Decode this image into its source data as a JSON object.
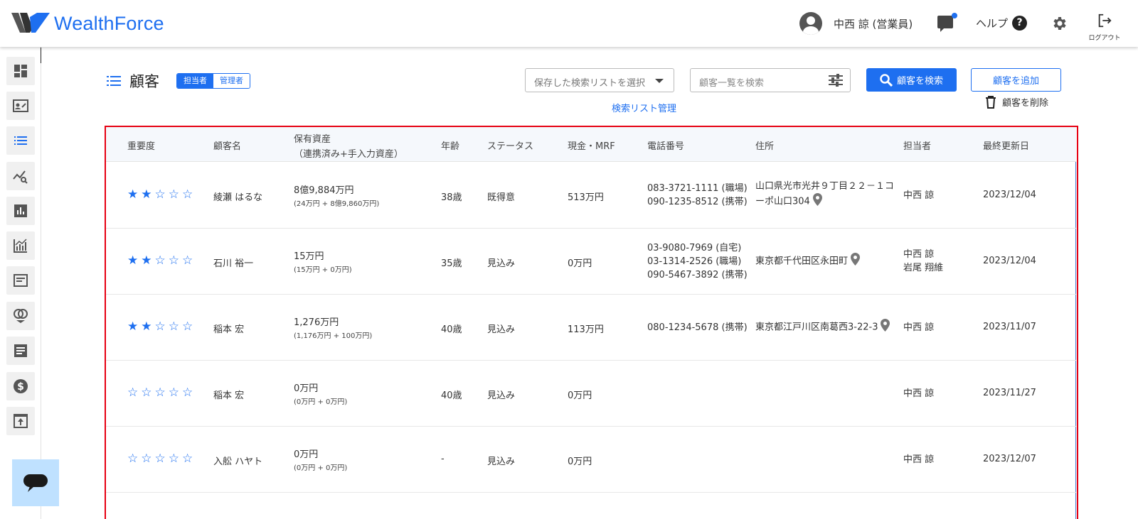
{
  "header": {
    "logo": "WealthForce",
    "user_name": "中西 諒 (営業員)",
    "help_label": "ヘルプ",
    "logout_label": "ログアウト"
  },
  "page": {
    "title": "顧客",
    "toggle_on": "担当者",
    "toggle_off": "管理者"
  },
  "toolbar": {
    "saved_list_placeholder": "保存した検索リストを選択",
    "list_manage_link": "検索リスト管理",
    "search_placeholder": "顧客一覧を検索",
    "search_button": "顧客を検索",
    "add_button": "顧客を追加",
    "delete_button": "顧客を削除"
  },
  "table": {
    "headers": {
      "importance": "重要度",
      "name": "顧客名",
      "assets_1": "保有資産",
      "assets_2": "（連携済み+手入力資産）",
      "age": "年齢",
      "status": "ステータス",
      "cash": "現金・MRF",
      "phone": "電話番号",
      "address": "住所",
      "rep": "担当者",
      "updated": "最終更新日"
    },
    "rows": [
      {
        "stars": 2,
        "name": "綾瀬 はるな",
        "assets": "8億9,884万円",
        "assets_sub": "(24万円 + 8億9,860万円)",
        "age": "38歳",
        "status": "既得意",
        "cash": "513万円",
        "phones": [
          "083-3721-1111 (職場)",
          "090-1235-8512 (携帯)"
        ],
        "address": [
          "山口県光市光井９丁目２２－１コ",
          "ーポ山口304"
        ],
        "reps": [
          "中西 諒"
        ],
        "updated": "2023/12/04"
      },
      {
        "stars": 2,
        "name": "石川 裕一",
        "assets": "15万円",
        "assets_sub": "(15万円 + 0万円)",
        "age": "35歳",
        "status": "見込み",
        "cash": "0万円",
        "phones": [
          "03-9080-7969 (自宅)",
          "03-1314-2526 (職場)",
          "090-5467-3892 (携帯)"
        ],
        "address": [
          "東京都千代田区永田町"
        ],
        "reps": [
          "中西 諒",
          "岩尾 翔維"
        ],
        "updated": "2023/12/04"
      },
      {
        "stars": 2,
        "name": "稲本 宏",
        "assets": "1,276万円",
        "assets_sub": "(1,176万円 + 100万円)",
        "age": "40歳",
        "status": "見込み",
        "cash": "113万円",
        "phones": [
          "080-1234-5678 (携帯)"
        ],
        "address": [
          "東京都江戸川区南葛西3-22-3"
        ],
        "reps": [
          "中西 諒"
        ],
        "updated": "2023/11/07"
      },
      {
        "stars": 0,
        "name": "稲本 宏",
        "assets": "0万円",
        "assets_sub": "(0万円 + 0万円)",
        "age": "40歳",
        "status": "見込み",
        "cash": "0万円",
        "phones": [],
        "address": [],
        "reps": [
          "中西 諒"
        ],
        "updated": "2023/11/27"
      },
      {
        "stars": 0,
        "name": "入舩 ハヤト",
        "assets": "0万円",
        "assets_sub": "(0万円 + 0万円)",
        "age": "-",
        "status": "見込み",
        "cash": "0万円",
        "phones": [],
        "address": [],
        "reps": [
          "中西 諒"
        ],
        "updated": "2023/12/07"
      }
    ]
  },
  "sidebar": {
    "icons": [
      "dashboard-icon",
      "contact-card-icon",
      "list-icon",
      "analytics-search-icon",
      "bar-chart-icon",
      "growth-chart-icon",
      "document-icon",
      "rings-icon",
      "article-icon",
      "dollar-icon",
      "upload-icon"
    ]
  },
  "colors": {
    "accent": "#1e6ff0",
    "highlight": "#e60012"
  }
}
